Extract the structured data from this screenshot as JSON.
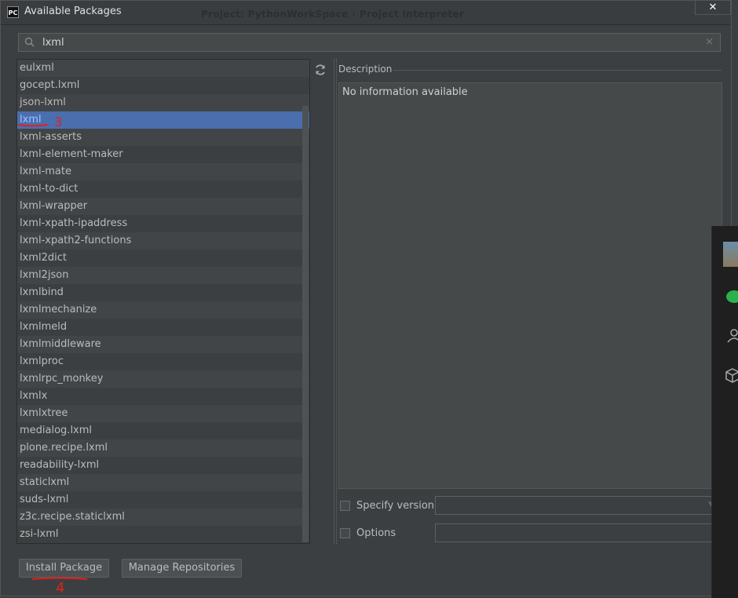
{
  "window": {
    "title": "Available Packages",
    "app_icon": "PC",
    "background_title": "Project: PythonWorkSpace  ›  Project Interpreter",
    "close_label": "✕"
  },
  "search": {
    "value": "lxml",
    "icon": "search-icon",
    "clear": "×"
  },
  "packages": [
    "eulxml",
    "gocept.lxml",
    "json-lxml",
    "lxml",
    "lxml-asserts",
    "lxml-element-maker",
    "lxml-mate",
    "lxml-to-dict",
    "lxml-wrapper",
    "lxml-xpath-ipaddress",
    "lxml-xpath2-functions",
    "lxml2dict",
    "lxml2json",
    "lxmlbind",
    "lxmlmechanize",
    "lxmlmeld",
    "lxmlmiddleware",
    "lxmlproc",
    "lxmlrpc_monkey",
    "lxmlx",
    "lxmlxtree",
    "medialog.lxml",
    "plone.recipe.lxml",
    "readability-lxml",
    "staticlxml",
    "suds-lxml",
    "z3c.recipe.staticlxml",
    "zsi-lxml"
  ],
  "selected_package": "lxml",
  "description": {
    "label": "Description",
    "text": "No information available"
  },
  "options": {
    "specify_version_label": "Specify version",
    "options_label": "Options"
  },
  "buttons": {
    "install": "Install Package",
    "manage": "Manage Repositories"
  },
  "annotations": {
    "step3": "3",
    "step4": "4",
    "color": "#e0211b"
  },
  "colors": {
    "background": "#3c3f41",
    "selection": "#4b6eaf"
  }
}
